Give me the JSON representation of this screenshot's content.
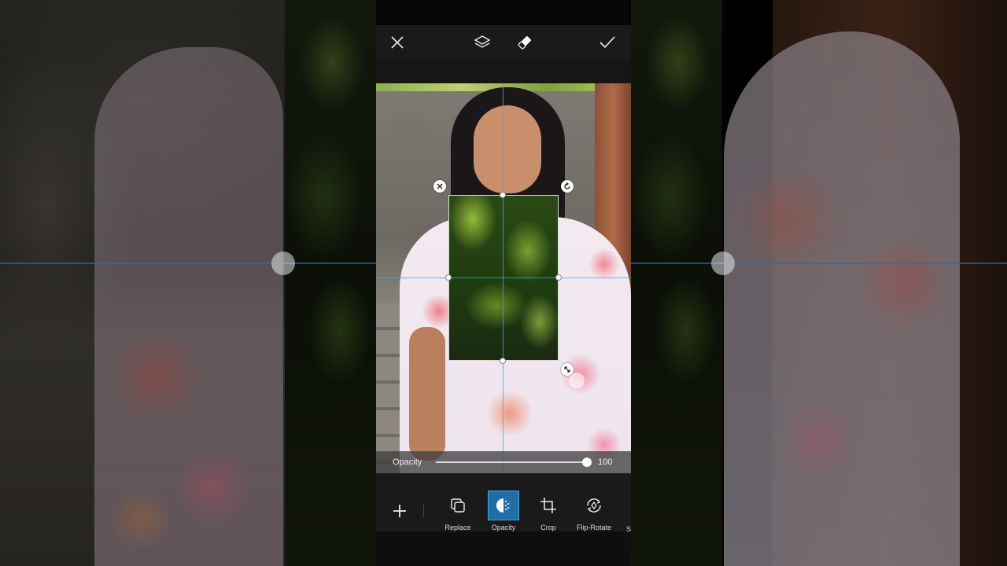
{
  "top_bar": {
    "close_icon": "close-icon",
    "layers_icon": "layers-icon",
    "eraser_icon": "eraser-icon",
    "apply_icon": "check-icon"
  },
  "opacity": {
    "label": "Opacity",
    "value": "100",
    "level_percent": 100
  },
  "toolbar": {
    "add_icon": "plus-icon",
    "tools": [
      {
        "label": "Replace",
        "icon": "replace-icon"
      },
      {
        "label": "Opacity",
        "icon": "opacity-icon"
      },
      {
        "label": "Crop",
        "icon": "crop-icon"
      },
      {
        "label": "Flip-Rotate",
        "icon": "flip-rotate-icon"
      }
    ],
    "clipped_label": "S"
  },
  "colors": {
    "accent": "#1f6ea8",
    "guide": "#46a0e6",
    "toolbar_bg": "#1a1a1a"
  }
}
